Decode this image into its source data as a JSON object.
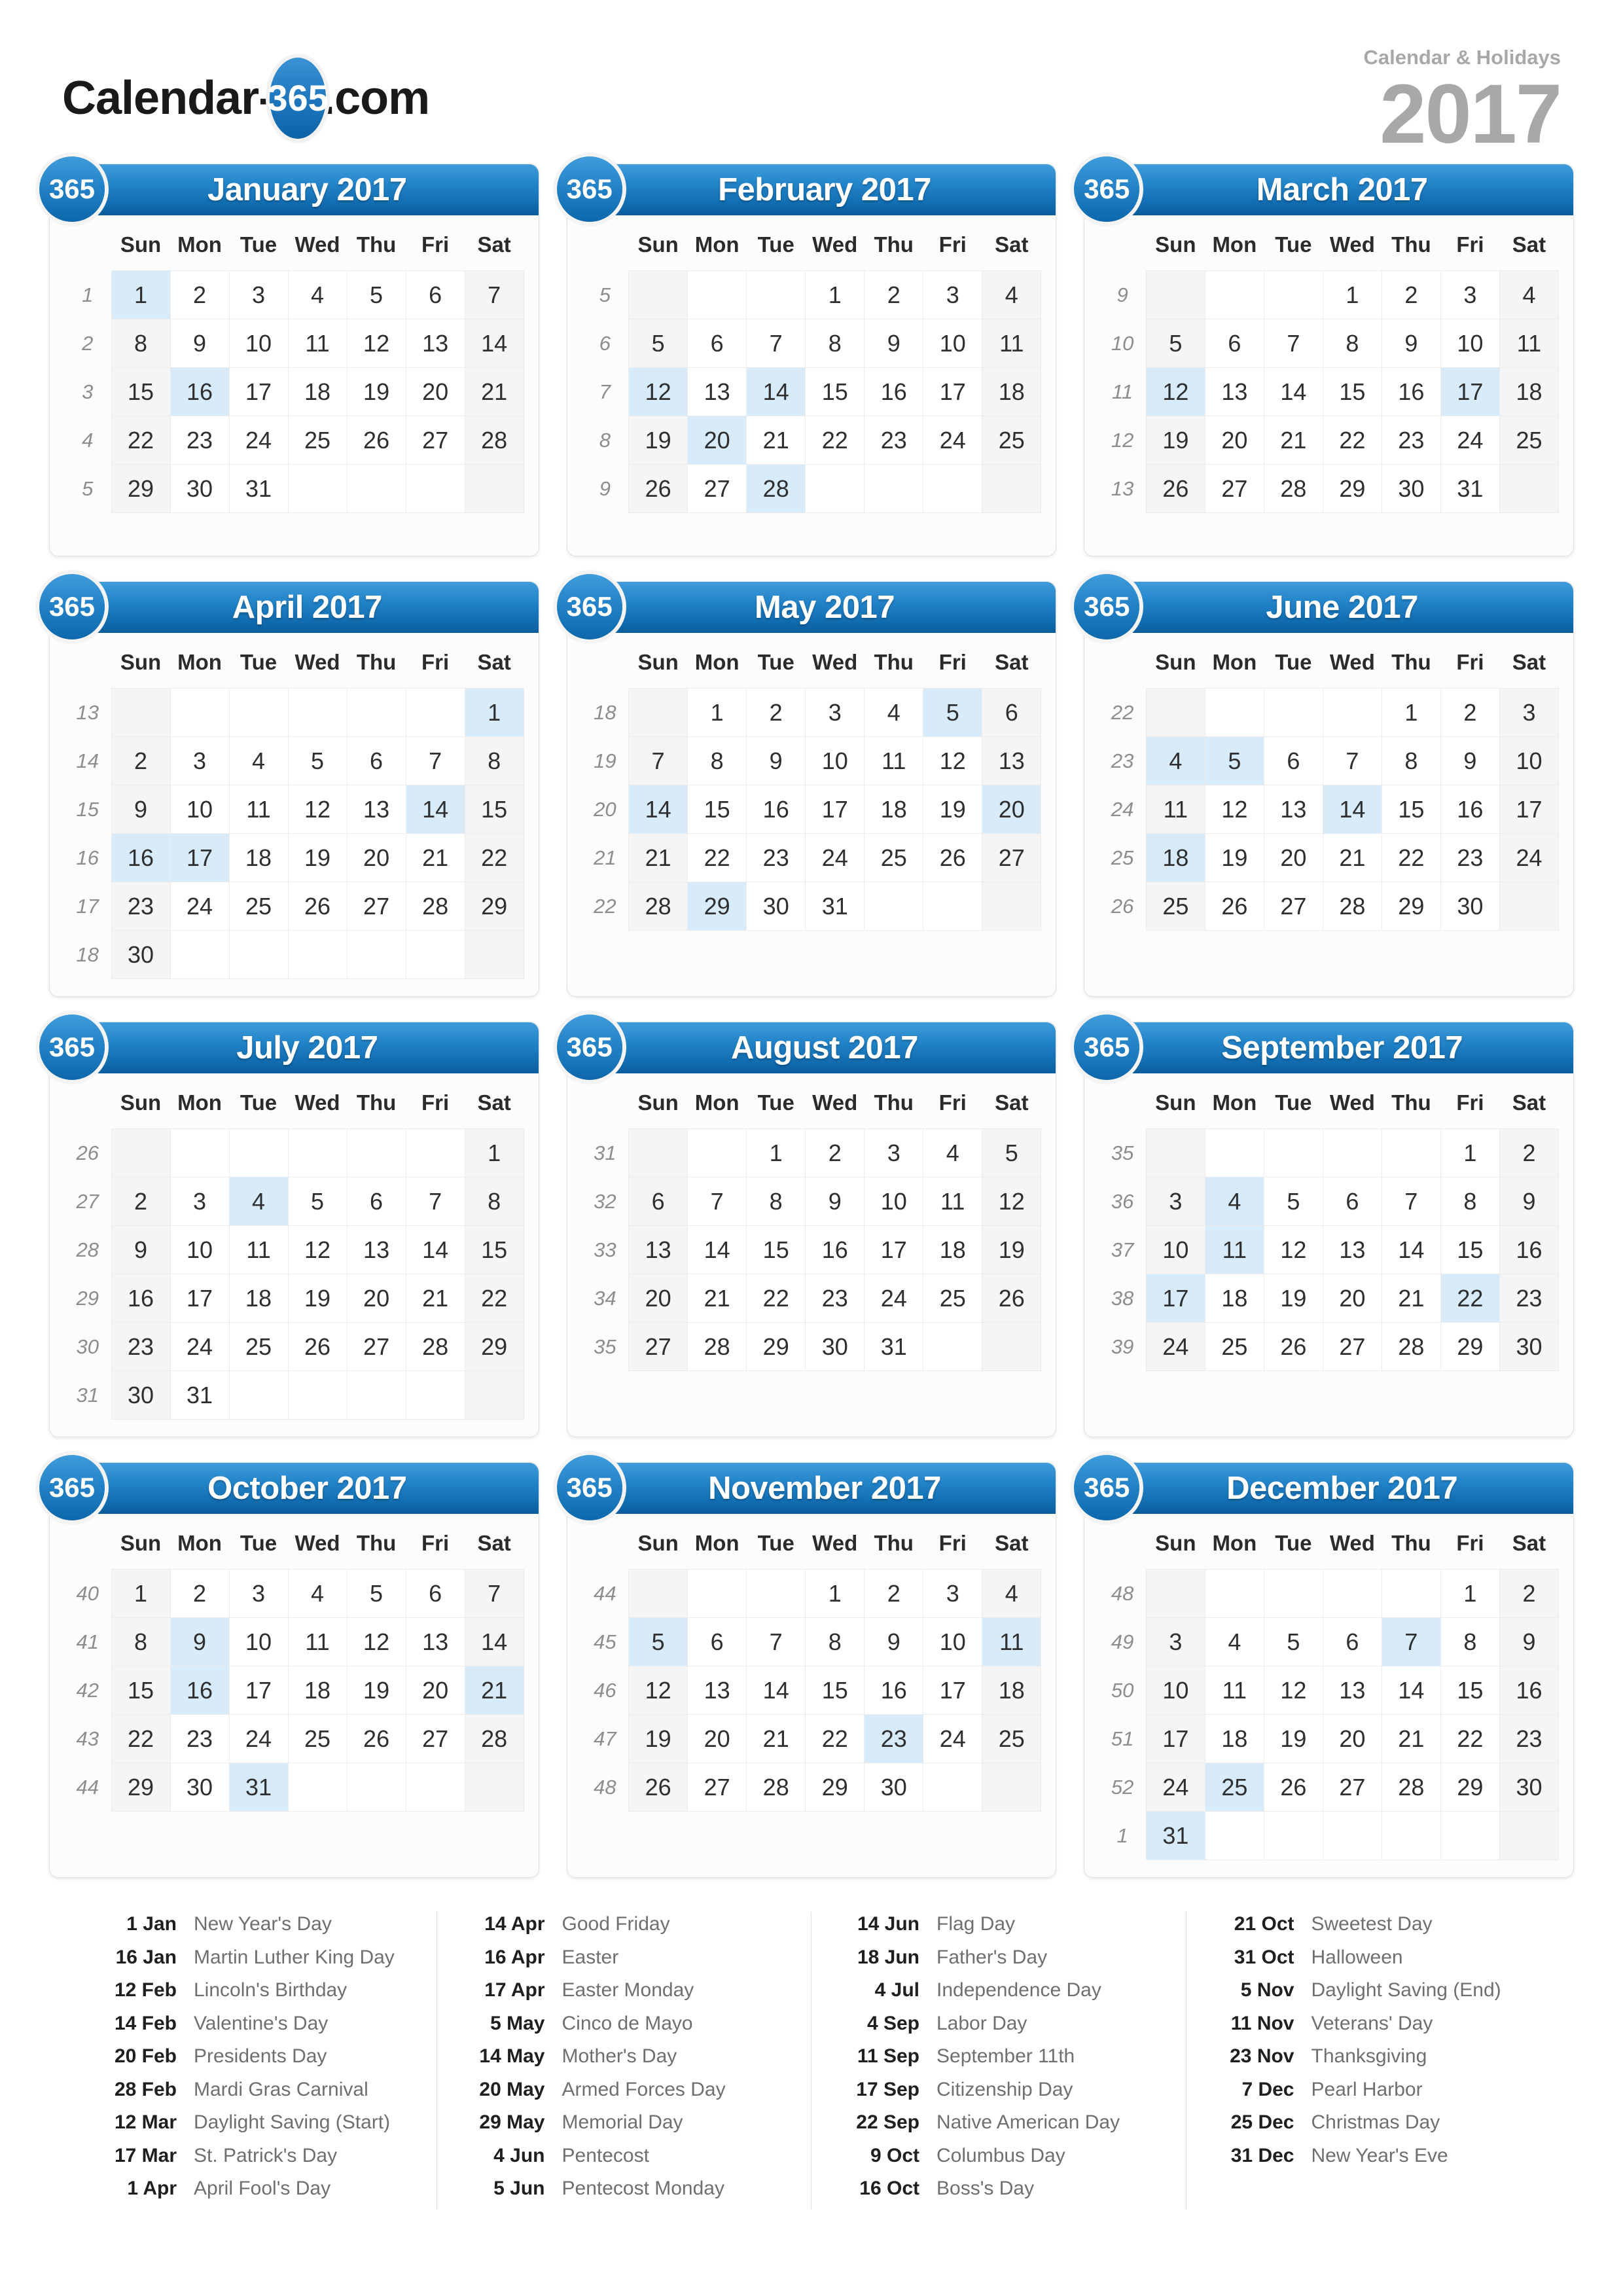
{
  "header": {
    "brand_left": "Calendar-",
    "brand_badge": "365",
    "brand_right": ".com",
    "subtitle": "Calendar & Holidays",
    "year": "2017"
  },
  "badge_label": "365",
  "dow": [
    "Sun",
    "Mon",
    "Tue",
    "Wed",
    "Thu",
    "Fri",
    "Sat"
  ],
  "colors": {
    "header_blue": "#2283c9",
    "header_blue_dark": "#0a5d9c",
    "highlight": "#d7ebfa",
    "weekend": "#f5f5f5",
    "year_gray": "#a8a8a8"
  },
  "months": [
    {
      "title": "January 2017",
      "weeks": [
        {
          "no": "1",
          "days": [
            "1",
            "2",
            "3",
            "4",
            "5",
            "6",
            "7"
          ]
        },
        {
          "no": "2",
          "days": [
            "8",
            "9",
            "10",
            "11",
            "12",
            "13",
            "14"
          ]
        },
        {
          "no": "3",
          "days": [
            "15",
            "16",
            "17",
            "18",
            "19",
            "20",
            "21"
          ]
        },
        {
          "no": "4",
          "days": [
            "22",
            "23",
            "24",
            "25",
            "26",
            "27",
            "28"
          ]
        },
        {
          "no": "5",
          "days": [
            "29",
            "30",
            "31",
            "",
            "",
            "",
            ""
          ]
        }
      ],
      "highlights": [
        "1",
        "16"
      ]
    },
    {
      "title": "February 2017",
      "weeks": [
        {
          "no": "5",
          "days": [
            "",
            "",
            "",
            "1",
            "2",
            "3",
            "4"
          ]
        },
        {
          "no": "6",
          "days": [
            "5",
            "6",
            "7",
            "8",
            "9",
            "10",
            "11"
          ]
        },
        {
          "no": "7",
          "days": [
            "12",
            "13",
            "14",
            "15",
            "16",
            "17",
            "18"
          ]
        },
        {
          "no": "8",
          "days": [
            "19",
            "20",
            "21",
            "22",
            "23",
            "24",
            "25"
          ]
        },
        {
          "no": "9",
          "days": [
            "26",
            "27",
            "28",
            "",
            "",
            "",
            ""
          ]
        }
      ],
      "highlights": [
        "12",
        "14",
        "20",
        "28"
      ]
    },
    {
      "title": "March 2017",
      "weeks": [
        {
          "no": "9",
          "days": [
            "",
            "",
            "",
            "1",
            "2",
            "3",
            "4"
          ]
        },
        {
          "no": "10",
          "days": [
            "5",
            "6",
            "7",
            "8",
            "9",
            "10",
            "11"
          ]
        },
        {
          "no": "11",
          "days": [
            "12",
            "13",
            "14",
            "15",
            "16",
            "17",
            "18"
          ]
        },
        {
          "no": "12",
          "days": [
            "19",
            "20",
            "21",
            "22",
            "23",
            "24",
            "25"
          ]
        },
        {
          "no": "13",
          "days": [
            "26",
            "27",
            "28",
            "29",
            "30",
            "31",
            ""
          ]
        }
      ],
      "highlights": [
        "12",
        "17"
      ]
    },
    {
      "title": "April 2017",
      "weeks": [
        {
          "no": "13",
          "days": [
            "",
            "",
            "",
            "",
            "",
            "",
            "1"
          ]
        },
        {
          "no": "14",
          "days": [
            "2",
            "3",
            "4",
            "5",
            "6",
            "7",
            "8"
          ]
        },
        {
          "no": "15",
          "days": [
            "9",
            "10",
            "11",
            "12",
            "13",
            "14",
            "15"
          ]
        },
        {
          "no": "16",
          "days": [
            "16",
            "17",
            "18",
            "19",
            "20",
            "21",
            "22"
          ]
        },
        {
          "no": "17",
          "days": [
            "23",
            "24",
            "25",
            "26",
            "27",
            "28",
            "29"
          ]
        },
        {
          "no": "18",
          "days": [
            "30",
            "",
            "",
            "",
            "",
            "",
            ""
          ]
        }
      ],
      "highlights": [
        "1",
        "14",
        "16",
        "17"
      ]
    },
    {
      "title": "May 2017",
      "weeks": [
        {
          "no": "18",
          "days": [
            "",
            "1",
            "2",
            "3",
            "4",
            "5",
            "6"
          ]
        },
        {
          "no": "19",
          "days": [
            "7",
            "8",
            "9",
            "10",
            "11",
            "12",
            "13"
          ]
        },
        {
          "no": "20",
          "days": [
            "14",
            "15",
            "16",
            "17",
            "18",
            "19",
            "20"
          ]
        },
        {
          "no": "21",
          "days": [
            "21",
            "22",
            "23",
            "24",
            "25",
            "26",
            "27"
          ]
        },
        {
          "no": "22",
          "days": [
            "28",
            "29",
            "30",
            "31",
            "",
            "",
            ""
          ]
        }
      ],
      "highlights": [
        "5",
        "14",
        "20",
        "29"
      ]
    },
    {
      "title": "June 2017",
      "weeks": [
        {
          "no": "22",
          "days": [
            "",
            "",
            "",
            "",
            "1",
            "2",
            "3"
          ]
        },
        {
          "no": "23",
          "days": [
            "4",
            "5",
            "6",
            "7",
            "8",
            "9",
            "10"
          ]
        },
        {
          "no": "24",
          "days": [
            "11",
            "12",
            "13",
            "14",
            "15",
            "16",
            "17"
          ]
        },
        {
          "no": "25",
          "days": [
            "18",
            "19",
            "20",
            "21",
            "22",
            "23",
            "24"
          ]
        },
        {
          "no": "26",
          "days": [
            "25",
            "26",
            "27",
            "28",
            "29",
            "30",
            ""
          ]
        }
      ],
      "highlights": [
        "4",
        "5",
        "14",
        "18"
      ]
    },
    {
      "title": "July 2017",
      "weeks": [
        {
          "no": "26",
          "days": [
            "",
            "",
            "",
            "",
            "",
            "",
            "1"
          ]
        },
        {
          "no": "27",
          "days": [
            "2",
            "3",
            "4",
            "5",
            "6",
            "7",
            "8"
          ]
        },
        {
          "no": "28",
          "days": [
            "9",
            "10",
            "11",
            "12",
            "13",
            "14",
            "15"
          ]
        },
        {
          "no": "29",
          "days": [
            "16",
            "17",
            "18",
            "19",
            "20",
            "21",
            "22"
          ]
        },
        {
          "no": "30",
          "days": [
            "23",
            "24",
            "25",
            "26",
            "27",
            "28",
            "29"
          ]
        },
        {
          "no": "31",
          "days": [
            "30",
            "31",
            "",
            "",
            "",
            "",
            ""
          ]
        }
      ],
      "highlights": [
        "4"
      ]
    },
    {
      "title": "August 2017",
      "weeks": [
        {
          "no": "31",
          "days": [
            "",
            "",
            "1",
            "2",
            "3",
            "4",
            "5"
          ]
        },
        {
          "no": "32",
          "days": [
            "6",
            "7",
            "8",
            "9",
            "10",
            "11",
            "12"
          ]
        },
        {
          "no": "33",
          "days": [
            "13",
            "14",
            "15",
            "16",
            "17",
            "18",
            "19"
          ]
        },
        {
          "no": "34",
          "days": [
            "20",
            "21",
            "22",
            "23",
            "24",
            "25",
            "26"
          ]
        },
        {
          "no": "35",
          "days": [
            "27",
            "28",
            "29",
            "30",
            "31",
            "",
            ""
          ]
        }
      ],
      "highlights": []
    },
    {
      "title": "September 2017",
      "weeks": [
        {
          "no": "35",
          "days": [
            "",
            "",
            "",
            "",
            "",
            "1",
            "2"
          ]
        },
        {
          "no": "36",
          "days": [
            "3",
            "4",
            "5",
            "6",
            "7",
            "8",
            "9"
          ]
        },
        {
          "no": "37",
          "days": [
            "10",
            "11",
            "12",
            "13",
            "14",
            "15",
            "16"
          ]
        },
        {
          "no": "38",
          "days": [
            "17",
            "18",
            "19",
            "20",
            "21",
            "22",
            "23"
          ]
        },
        {
          "no": "39",
          "days": [
            "24",
            "25",
            "26",
            "27",
            "28",
            "29",
            "30"
          ]
        }
      ],
      "highlights": [
        "4",
        "11",
        "17",
        "22"
      ]
    },
    {
      "title": "October 2017",
      "weeks": [
        {
          "no": "40",
          "days": [
            "1",
            "2",
            "3",
            "4",
            "5",
            "6",
            "7"
          ]
        },
        {
          "no": "41",
          "days": [
            "8",
            "9",
            "10",
            "11",
            "12",
            "13",
            "14"
          ]
        },
        {
          "no": "42",
          "days": [
            "15",
            "16",
            "17",
            "18",
            "19",
            "20",
            "21"
          ]
        },
        {
          "no": "43",
          "days": [
            "22",
            "23",
            "24",
            "25",
            "26",
            "27",
            "28"
          ]
        },
        {
          "no": "44",
          "days": [
            "29",
            "30",
            "31",
            "",
            "",
            "",
            ""
          ]
        }
      ],
      "highlights": [
        "9",
        "16",
        "21",
        "31"
      ]
    },
    {
      "title": "November 2017",
      "weeks": [
        {
          "no": "44",
          "days": [
            "",
            "",
            "",
            "1",
            "2",
            "3",
            "4"
          ]
        },
        {
          "no": "45",
          "days": [
            "5",
            "6",
            "7",
            "8",
            "9",
            "10",
            "11"
          ]
        },
        {
          "no": "46",
          "days": [
            "12",
            "13",
            "14",
            "15",
            "16",
            "17",
            "18"
          ]
        },
        {
          "no": "47",
          "days": [
            "19",
            "20",
            "21",
            "22",
            "23",
            "24",
            "25"
          ]
        },
        {
          "no": "48",
          "days": [
            "26",
            "27",
            "28",
            "29",
            "30",
            "",
            ""
          ]
        }
      ],
      "highlights": [
        "5",
        "11",
        "23"
      ]
    },
    {
      "title": "December 2017",
      "weeks": [
        {
          "no": "48",
          "days": [
            "",
            "",
            "",
            "",
            "",
            "1",
            "2"
          ]
        },
        {
          "no": "49",
          "days": [
            "3",
            "4",
            "5",
            "6",
            "7",
            "8",
            "9"
          ]
        },
        {
          "no": "50",
          "days": [
            "10",
            "11",
            "12",
            "13",
            "14",
            "15",
            "16"
          ]
        },
        {
          "no": "51",
          "days": [
            "17",
            "18",
            "19",
            "20",
            "21",
            "22",
            "23"
          ]
        },
        {
          "no": "52",
          "days": [
            "24",
            "25",
            "26",
            "27",
            "28",
            "29",
            "30"
          ]
        },
        {
          "no": "1",
          "days": [
            "31",
            "",
            "",
            "",
            "",
            "",
            ""
          ]
        }
      ],
      "highlights": [
        "7",
        "25",
        "31"
      ]
    }
  ],
  "holiday_columns": [
    [
      {
        "date": "1 Jan",
        "name": "New Year's Day"
      },
      {
        "date": "16 Jan",
        "name": "Martin Luther King Day"
      },
      {
        "date": "12 Feb",
        "name": "Lincoln's Birthday"
      },
      {
        "date": "14 Feb",
        "name": "Valentine's Day"
      },
      {
        "date": "20 Feb",
        "name": "Presidents Day"
      },
      {
        "date": "28 Feb",
        "name": "Mardi Gras Carnival"
      },
      {
        "date": "12 Mar",
        "name": "Daylight Saving (Start)"
      },
      {
        "date": "17 Mar",
        "name": "St. Patrick's Day"
      },
      {
        "date": "1 Apr",
        "name": "April Fool's Day"
      }
    ],
    [
      {
        "date": "14 Apr",
        "name": "Good Friday"
      },
      {
        "date": "16 Apr",
        "name": "Easter"
      },
      {
        "date": "17 Apr",
        "name": "Easter Monday"
      },
      {
        "date": "5 May",
        "name": "Cinco de Mayo"
      },
      {
        "date": "14 May",
        "name": "Mother's Day"
      },
      {
        "date": "20 May",
        "name": "Armed Forces Day"
      },
      {
        "date": "29 May",
        "name": "Memorial Day"
      },
      {
        "date": "4 Jun",
        "name": "Pentecost"
      },
      {
        "date": "5 Jun",
        "name": "Pentecost Monday"
      }
    ],
    [
      {
        "date": "14 Jun",
        "name": "Flag Day"
      },
      {
        "date": "18 Jun",
        "name": "Father's Day"
      },
      {
        "date": "4 Jul",
        "name": "Independence Day"
      },
      {
        "date": "4 Sep",
        "name": "Labor Day"
      },
      {
        "date": "11 Sep",
        "name": "September 11th"
      },
      {
        "date": "17 Sep",
        "name": "Citizenship Day"
      },
      {
        "date": "22 Sep",
        "name": "Native American Day"
      },
      {
        "date": "9 Oct",
        "name": "Columbus Day"
      },
      {
        "date": "16 Oct",
        "name": "Boss's Day"
      }
    ],
    [
      {
        "date": "21 Oct",
        "name": "Sweetest Day"
      },
      {
        "date": "31 Oct",
        "name": "Halloween"
      },
      {
        "date": "5 Nov",
        "name": "Daylight Saving (End)"
      },
      {
        "date": "11 Nov",
        "name": "Veterans' Day"
      },
      {
        "date": "23 Nov",
        "name": "Thanksgiving"
      },
      {
        "date": "7 Dec",
        "name": "Pearl Harbor"
      },
      {
        "date": "25 Dec",
        "name": "Christmas Day"
      },
      {
        "date": "31 Dec",
        "name": "New Year's Eve"
      }
    ]
  ]
}
